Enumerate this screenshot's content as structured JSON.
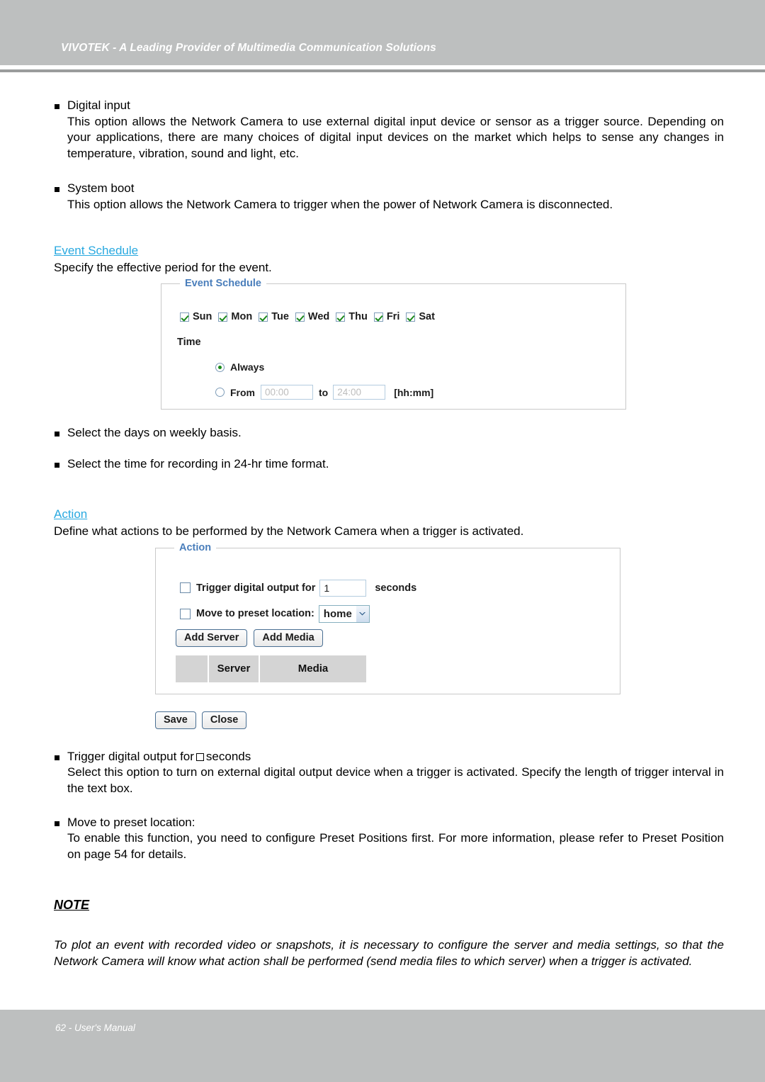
{
  "header": {
    "title": "VIVOTEK - A Leading Provider of Multimedia Communication Solutions"
  },
  "footer": {
    "text": "62 - User's Manual"
  },
  "bullets_top": [
    {
      "head": "Digital input",
      "body": "This option allows the Network Camera to use external digital input device or sensor as a trigger source. Depending on your applications, there are many choices of digital input devices on the market which helps to sense any changes in temperature, vibration, sound and light, etc."
    },
    {
      "head": "System boot",
      "body": "This option allows the Network Camera to trigger when the power of Network Camera is disconnected."
    }
  ],
  "event_schedule": {
    "link": "Event Schedule",
    "description": "Specify the effective period for the event.",
    "widget": {
      "legend": "Event Schedule",
      "days": [
        {
          "label": "Sun",
          "checked": true
        },
        {
          "label": "Mon",
          "checked": true
        },
        {
          "label": "Tue",
          "checked": true
        },
        {
          "label": "Wed",
          "checked": true
        },
        {
          "label": "Thu",
          "checked": true
        },
        {
          "label": "Fri",
          "checked": true
        },
        {
          "label": "Sat",
          "checked": true
        }
      ],
      "time_label": "Time",
      "always_label": "Always",
      "always_selected": true,
      "from_label": "From",
      "from_value": "00:00",
      "to_label": "to",
      "to_value": "24:00",
      "format_label": "[hh:mm]"
    },
    "bullets": [
      "Select the days on weekly basis.",
      "Select the time for recording in 24-hr time format."
    ]
  },
  "action": {
    "link": "Action",
    "description": "Define what actions to be performed by the Network Camera when a trigger is activated.",
    "widget": {
      "legend": "Action",
      "trigger_label": "Trigger digital output for",
      "trigger_checked": false,
      "trigger_seconds_value": "1",
      "seconds_label": "seconds",
      "preset_label": "Move to preset location:",
      "preset_checked": false,
      "preset_value": "home",
      "add_server_label": "Add Server",
      "add_media_label": "Add Media",
      "table_headers": [
        "",
        "Server",
        "Media"
      ]
    },
    "save_label": "Save",
    "close_label": "Close",
    "bullets": [
      {
        "head_before": "Trigger digital output for",
        "head_after": "seconds",
        "body": "Select this option to turn on external digital output device when a trigger is activated. Specify the length of trigger interval in the text box."
      },
      {
        "head_before": "Move to preset location:",
        "head_after": "",
        "body": "To enable this function, you need to configure Preset Positions first. For more information, please refer to Preset Position on page 54 for details."
      }
    ]
  },
  "note": {
    "title": "NOTE",
    "body": "To plot an event with recorded video or snapshots, it is necessary to configure the server and media settings, so that the Network Camera will know what action shall be performed (send media files to which server) when a trigger is activated."
  },
  "colors": {
    "chrome_gray": "#bdbfbf",
    "rule_gray": "#9a9c9c",
    "link_blue": "#29a9e0",
    "legend_blue": "#4a7ebb",
    "check_green": "#1a8a1a",
    "table_header_gray": "#d4d4d4"
  }
}
